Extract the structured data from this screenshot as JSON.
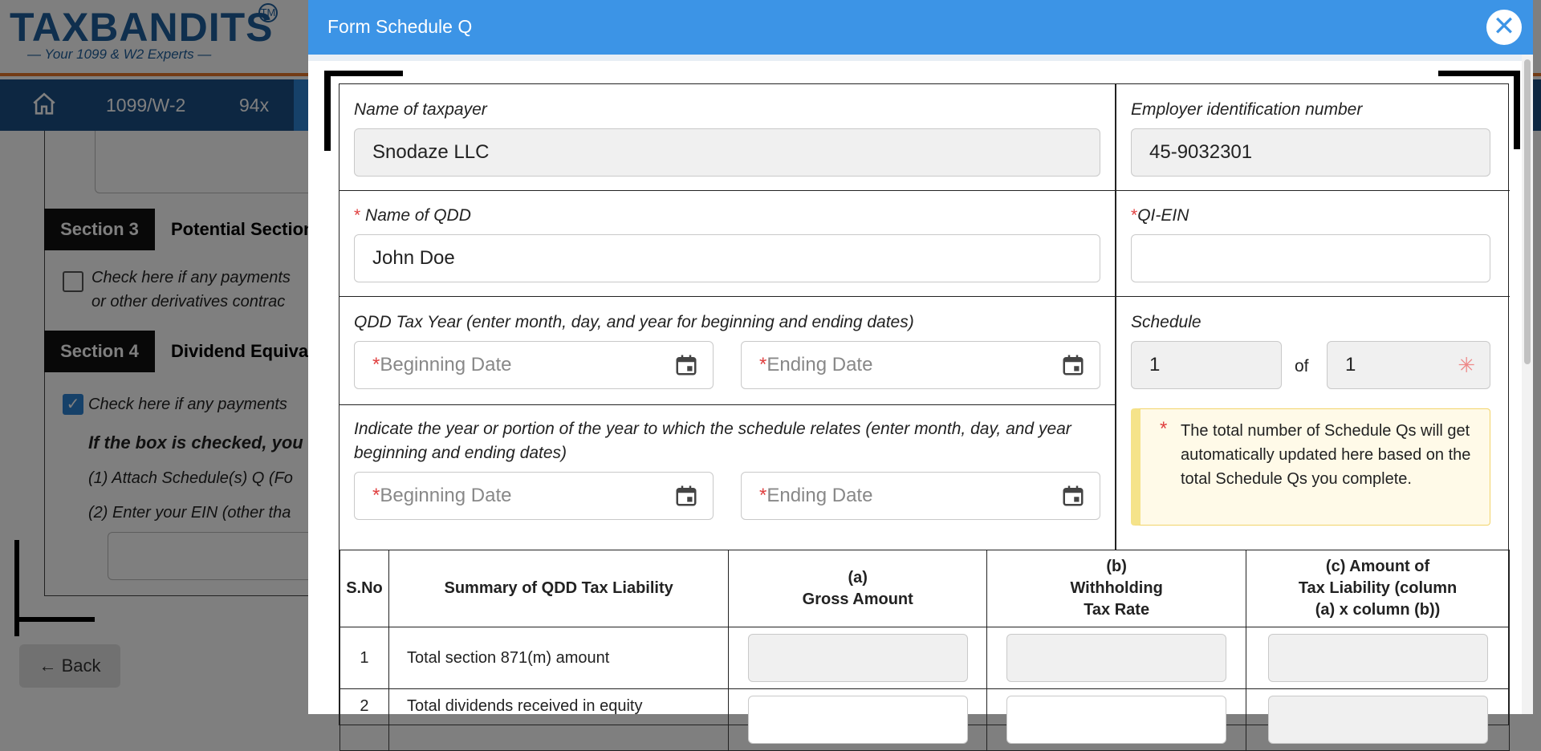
{
  "background": {
    "logo": {
      "text": "TAXBANDITS",
      "tagline": "— Your 1099 & W2 Experts —",
      "tm": "TM"
    },
    "nav": {
      "items": [
        "1099/W-2",
        "94x"
      ]
    },
    "section3": {
      "tag": "Section 3",
      "title": "Potential Section"
    },
    "section3_text": [
      "Check here if any payments",
      "or other derivatives contrac"
    ],
    "section4": {
      "tag": "Section 4",
      "title": "Dividend Equiva"
    },
    "section4_text": [
      "Check here if any payments"
    ],
    "section4_bold": "If the box is checked, you",
    "section4_steps": [
      "(1) Attach Schedule(s) Q (Fo",
      "(2) Enter your EIN (other tha"
    ],
    "back_label": "Back"
  },
  "modal": {
    "title": "Form Schedule Q",
    "close_icon": "close-icon",
    "taxpayer": {
      "label": "Name of taxpayer",
      "value": "Snodaze LLC"
    },
    "ein": {
      "label": "Employer identification number",
      "value": "45-9032301"
    },
    "qdd_name": {
      "req": "*",
      "label": " Name of QDD",
      "value": "John Doe"
    },
    "qi_ein": {
      "req": "*",
      "label": "QI-EIN",
      "value": ""
    },
    "tax_year": {
      "label": "QDD Tax Year (enter month, day, and year for beginning and ending dates)",
      "begin_placeholder": "Beginning Date",
      "end_placeholder": "Ending Date"
    },
    "portion_year": {
      "label_line1": "Indicate the year or portion of the year to which the schedule relates (enter month, day, and year",
      "label_line2": "beginning and ending dates)",
      "begin_placeholder": "Beginning Date",
      "end_placeholder": "Ending Date"
    },
    "schedule": {
      "label": "Schedule",
      "current": "1",
      "of": "of",
      "total": "1"
    },
    "note": "The total number of Schedule Qs will get automatically updated here based on the total Schedule Qs you complete.",
    "table": {
      "headers": {
        "sno": "S.No",
        "summary": "Summary of QDD Tax Liability",
        "a_line1": "(a)",
        "a_line2": "Gross Amount",
        "b_line1": "(b)",
        "b_line2": "Withholding",
        "b_line3": "Tax Rate",
        "c_line1": "(c) Amount of",
        "c_line2": "Tax Liability (column",
        "c_line3": "(a) x column (b))"
      },
      "rows": [
        {
          "sno": "1",
          "desc": "Total section 871(m) amount"
        },
        {
          "sno": "2",
          "desc": "Total dividends received in equity"
        }
      ]
    }
  }
}
